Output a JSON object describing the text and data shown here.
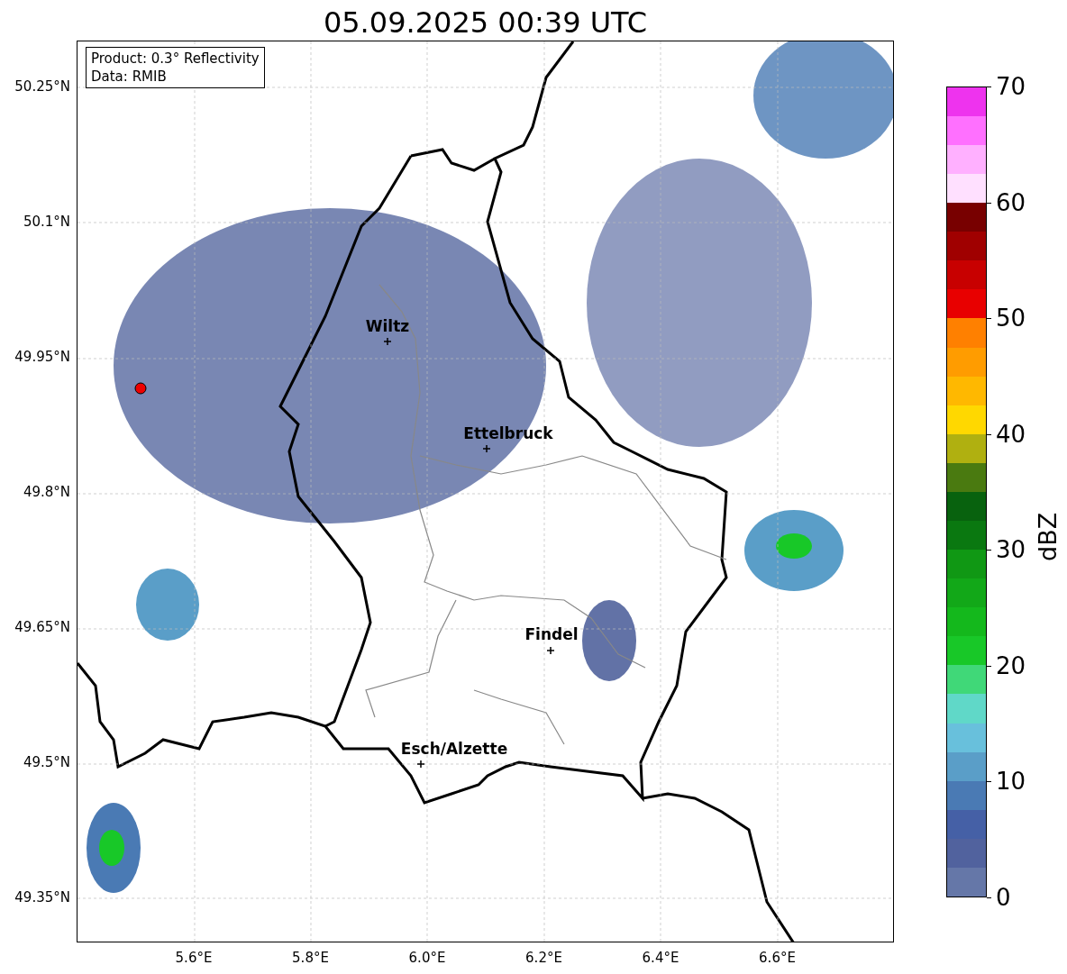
{
  "title": "05.09.2025 00:39 UTC",
  "info_box": {
    "lines": [
      "Product: 0.3° Reflectivity",
      "Data: RMIB"
    ]
  },
  "y_ticks": [
    "50.25°N",
    "50.1°N",
    "49.95°N",
    "49.8°N",
    "49.65°N",
    "49.5°N",
    "49.35°N"
  ],
  "x_ticks": [
    "5.6°E",
    "5.8°E",
    "6.0°E",
    "6.2°E",
    "6.4°E",
    "6.6°E"
  ],
  "places": [
    {
      "kind": "radar"
    },
    {
      "kind": "city",
      "name": "Wiltz"
    },
    {
      "kind": "city",
      "name": "Ettelbruck"
    },
    {
      "kind": "city",
      "name": "Findel"
    },
    {
      "kind": "city",
      "name": "Esch/Alzette"
    }
  ],
  "colorbar": {
    "label": "dBZ",
    "ticks": [
      "70",
      "60",
      "50",
      "40",
      "30",
      "20",
      "10",
      "0"
    ],
    "bins": [
      {
        "color": "#6577a8"
      },
      {
        "color": "#51629e"
      },
      {
        "color": "#4560a6"
      },
      {
        "color": "#4a7ab4"
      },
      {
        "color": "#5a9ec8"
      },
      {
        "color": "#68c0dc"
      },
      {
        "color": "#60d8c8"
      },
      {
        "color": "#40d878"
      },
      {
        "color": "#18c828"
      },
      {
        "color": "#14b81c"
      },
      {
        "color": "#12a818"
      },
      {
        "color": "#109814"
      },
      {
        "color": "#0a7810"
      },
      {
        "color": "#08620e"
      },
      {
        "color": "#4a7a10"
      },
      {
        "color": "#b0b010"
      },
      {
        "color": "#ffd800"
      },
      {
        "color": "#ffb800"
      },
      {
        "color": "#ff9c00"
      },
      {
        "color": "#ff8000"
      },
      {
        "color": "#e80000"
      },
      {
        "color": "#c80000"
      },
      {
        "color": "#a00000"
      },
      {
        "color": "#780000"
      },
      {
        "color": "#ffe0ff"
      },
      {
        "color": "#ffb0ff"
      },
      {
        "color": "#ff70ff"
      },
      {
        "color": "#ee33ee"
      }
    ]
  }
}
